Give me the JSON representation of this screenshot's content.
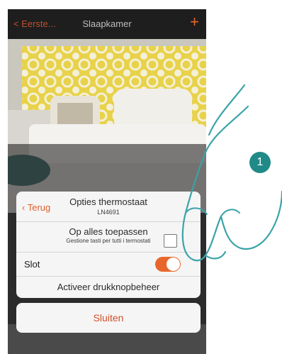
{
  "navbar": {
    "back_label": "< Eerste...",
    "title": "Slaapkamer",
    "add_icon": "+"
  },
  "dialog": {
    "back_label": "Terug",
    "title": "Opties thermostaat",
    "subtitle": "LN4691",
    "apply_all": {
      "title": "Op alles toepassen",
      "subtitle": "Gestione tasti per tutti i termostati",
      "checked": false
    },
    "lock": {
      "label": "Slot",
      "on": true
    },
    "activate_label": "Activeer drukknopbeheer"
  },
  "close_label": "Sluiten",
  "step_number": "1",
  "colors": {
    "accent": "#e8662b",
    "badge": "#1f8a88",
    "navbar": "#1e1e1e"
  }
}
